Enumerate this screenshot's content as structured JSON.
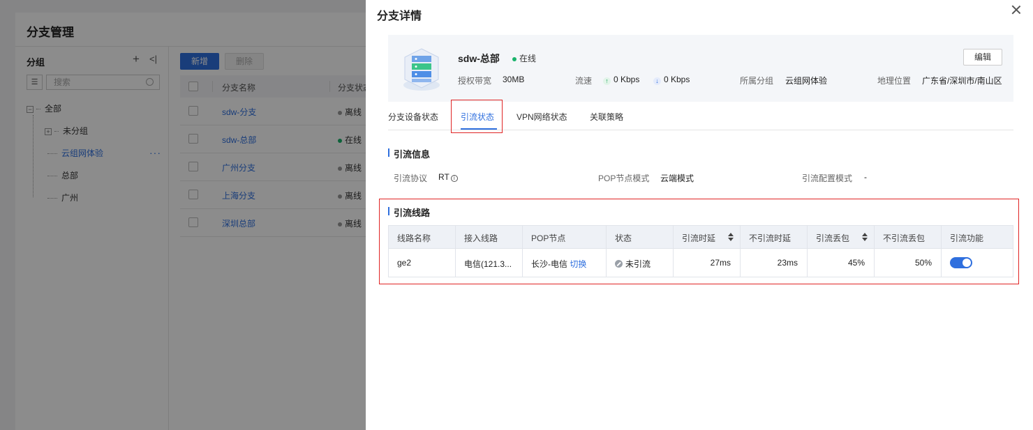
{
  "background": {
    "page_title": "分支管理",
    "tree": {
      "header": "分组",
      "add_icon": "plus-icon",
      "collapse_icon": "collapse-left-icon",
      "search_placeholder": "搜索",
      "nodes": [
        {
          "label": "全部"
        },
        {
          "label": "未分组"
        },
        {
          "label": "云组网体验"
        },
        {
          "label": "总部"
        },
        {
          "label": "广州"
        }
      ],
      "more": "···"
    },
    "toolbar": {
      "new_label": "新增",
      "delete_label": "删除"
    },
    "table": {
      "columns": [
        "分支名称",
        "分支状态"
      ],
      "rows": [
        {
          "name": "sdw-分支",
          "status": "离线"
        },
        {
          "name": "sdw-总部",
          "status": "在线"
        },
        {
          "name": "广州分支",
          "status": "离线"
        },
        {
          "name": "上海分支",
          "status": "离线"
        },
        {
          "name": "深圳总部",
          "status": "离线"
        }
      ]
    }
  },
  "drawer": {
    "title": "分支详情",
    "summary": {
      "name": "sdw-总部",
      "status": "在线",
      "edit_label": "编辑",
      "bandwidth_label": "授权带宽",
      "bandwidth_value": "30MB",
      "speed_label": "流速",
      "speed_up": "0 Kbps",
      "speed_down": "0 Kbps",
      "group_label": "所属分组",
      "group_value": "云组网体验",
      "location_label": "地理位置",
      "location_value": "广东省/深圳市/南山区"
    },
    "tabs": [
      {
        "label": "分支设备状态"
      },
      {
        "label": "引流状态"
      },
      {
        "label": "VPN网络状态"
      },
      {
        "label": "关联策略"
      }
    ],
    "traffic_info": {
      "title": "引流信息",
      "protocol_label": "引流协议",
      "protocol_value": "RT",
      "pop_mode_label": "POP节点模式",
      "pop_mode_value": "云端模式",
      "config_mode_label": "引流配置模式",
      "config_mode_value": "-"
    },
    "route": {
      "title": "引流线路",
      "columns": [
        "线路名称",
        "接入线路",
        "POP节点",
        "状态",
        "引流时延",
        "不引流时延",
        "引流丢包",
        "不引流丢包",
        "引流功能"
      ],
      "rows": [
        {
          "name": "ge2",
          "access": "电信(121.3...",
          "pop": "长沙-电信",
          "switch_label": "切换",
          "status": "未引流",
          "delay": "27ms",
          "no_delay": "23ms",
          "loss": "45%",
          "no_loss": "50%",
          "enabled": true
        }
      ]
    }
  },
  "colors": {
    "accent": "#2f6fde",
    "online": "#19b36b",
    "offline": "#999999",
    "highlight": "#e02424"
  }
}
